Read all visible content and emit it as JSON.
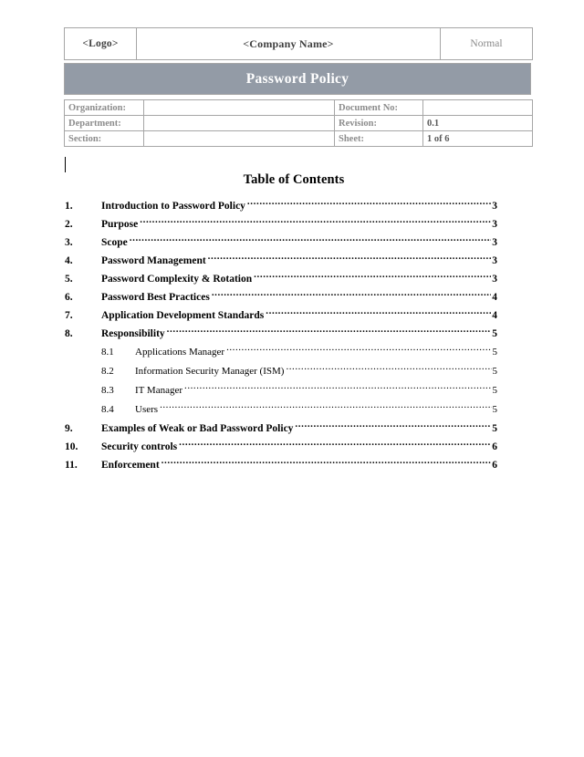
{
  "document": {
    "header": {
      "logo_placeholder": "<Logo>",
      "company_placeholder": "<Company Name>",
      "classification": "Normal",
      "title": "Password Policy"
    },
    "metadata": [
      {
        "label": "Organization:",
        "value": "",
        "label2": "Document No:",
        "value2": ""
      },
      {
        "label": "Department:",
        "value": "",
        "label2": "Revision:",
        "value2": "0.1"
      },
      {
        "label": "Section:",
        "value": "",
        "label2": "Sheet:",
        "value2": "1 of 6"
      }
    ],
    "toc": {
      "heading": "Table of Contents",
      "entries": [
        {
          "number": "1.",
          "title": "Introduction to Password Policy",
          "page": "3",
          "level": 1
        },
        {
          "number": "2.",
          "title": "Purpose",
          "page": "3",
          "level": 1
        },
        {
          "number": "3.",
          "title": "Scope",
          "page": "3",
          "level": 1
        },
        {
          "number": "4.",
          "title": "Password Management",
          "page": "3",
          "level": 1
        },
        {
          "number": "5.",
          "title": "Password Complexity & Rotation",
          "page": "3",
          "level": 1
        },
        {
          "number": "6.",
          "title": "Password Best Practices",
          "page": "4",
          "level": 1
        },
        {
          "number": "7.",
          "title": "Application Development Standards",
          "page": "4",
          "level": 1
        },
        {
          "number": "8.",
          "title": "Responsibility",
          "page": "5",
          "level": 1
        },
        {
          "number": "8.1",
          "title": "Applications Manager",
          "page": "5",
          "level": 2
        },
        {
          "number": "8.2",
          "title": "Information Security Manager (ISM)",
          "page": "5",
          "level": 2
        },
        {
          "number": "8.3",
          "title": "IT Manager",
          "page": "5",
          "level": 2
        },
        {
          "number": "8.4",
          "title": "Users",
          "page": "5",
          "level": 2
        },
        {
          "number": "9.",
          "title": "Examples of Weak or Bad Password Policy",
          "page": "5",
          "level": 1
        },
        {
          "number": "10.",
          "title": "Security controls",
          "page": "6",
          "level": 1
        },
        {
          "number": "11.",
          "title": "Enforcement",
          "page": "6",
          "level": 1
        }
      ]
    }
  },
  "colors": {
    "title_band": "#939ba6",
    "table_border": "#a6a6a6",
    "label_gray": "#8c8c8c",
    "value_gray": "#595959",
    "page_background": "#ffffff"
  }
}
